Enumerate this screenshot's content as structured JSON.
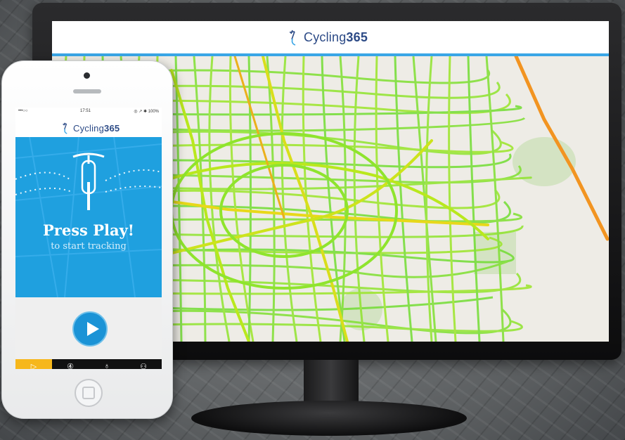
{
  "desktop": {
    "logo_text_regular": "Cycling",
    "logo_text_bold": "365"
  },
  "phone": {
    "status": {
      "left": "•••○○",
      "time": "17:51",
      "right": "◎ ↗ ✱ 100%"
    },
    "logo_text_regular": "Cycling",
    "logo_text_bold": "365",
    "hero_title": "Press Play!",
    "hero_subtitle": "to start tracking",
    "tabs": [
      {
        "icon": "play-circle-icon",
        "glyph": "▷",
        "active": true
      },
      {
        "icon": "counter-icon",
        "glyph": "④",
        "active": false
      },
      {
        "icon": "medal-icon",
        "glyph": "♁",
        "active": false
      },
      {
        "icon": "user-icon",
        "glyph": "⚇",
        "active": false
      }
    ]
  },
  "colors": {
    "accent_blue": "#1fa0df",
    "route_green": "#7fe031",
    "route_yellow": "#e8d81a",
    "route_orange": "#f29421",
    "tab_active": "#f6b71b"
  }
}
